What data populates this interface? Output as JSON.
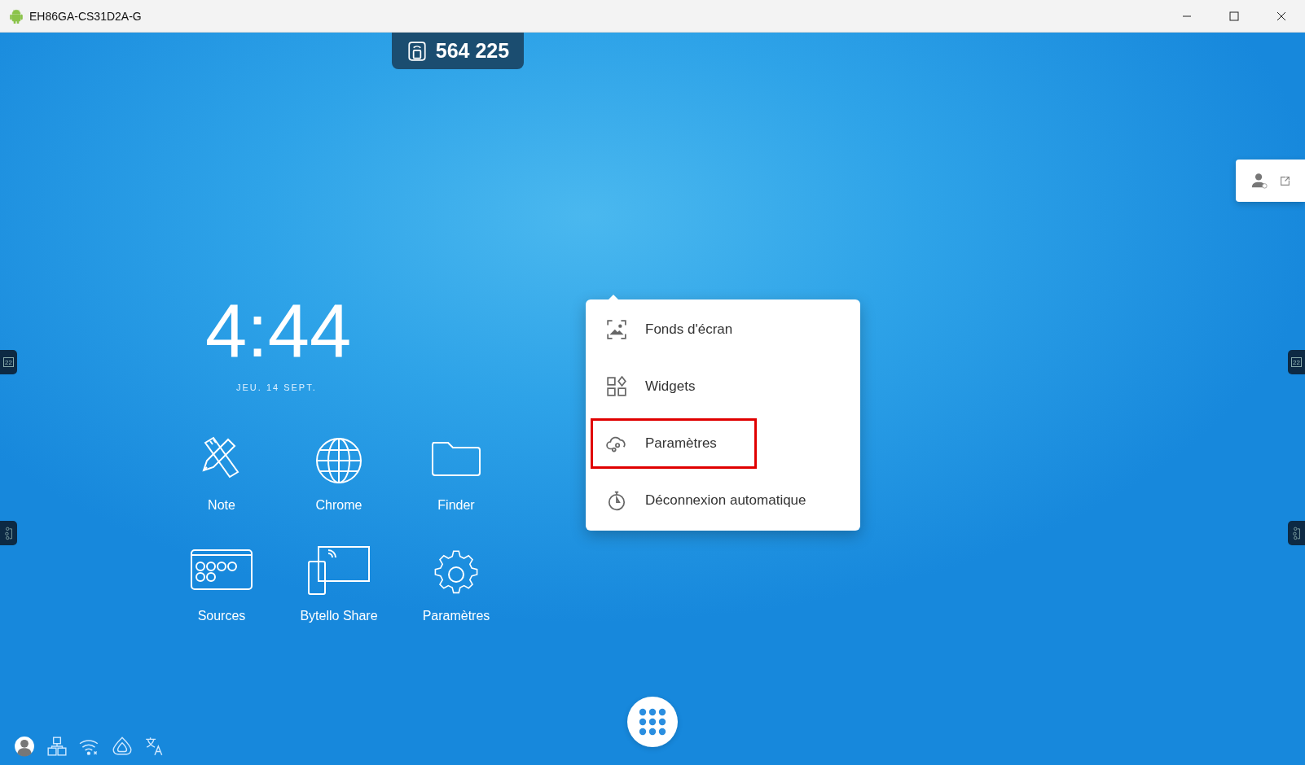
{
  "window": {
    "title": "EH86GA-CS31D2A-G"
  },
  "connection_code": "564 225",
  "clock": {
    "time": "4:44",
    "date": "JEU. 14 SEPT."
  },
  "apps": [
    {
      "label": "Note",
      "kind": "note"
    },
    {
      "label": "Chrome",
      "kind": "globe"
    },
    {
      "label": "Finder",
      "kind": "folder"
    },
    {
      "label": "Sources",
      "kind": "sources"
    },
    {
      "label": "Bytello Share",
      "kind": "share"
    },
    {
      "label": "Paramètres",
      "kind": "gear"
    }
  ],
  "context_menu": {
    "items": [
      {
        "label": "Fonds d'écran",
        "kind": "wallpaper",
        "highlighted": false
      },
      {
        "label": "Widgets",
        "kind": "widgets",
        "highlighted": false
      },
      {
        "label": "Paramètres",
        "kind": "cloud",
        "highlighted": true
      },
      {
        "label": "Déconnexion automatique",
        "kind": "timer",
        "highlighted": false
      }
    ]
  },
  "left_tabs": [
    {
      "kind": "calendar",
      "text": "22"
    },
    {
      "kind": "apps"
    }
  ],
  "right_tabs": [
    {
      "kind": "calendar",
      "text": "22"
    },
    {
      "kind": "apps"
    }
  ]
}
